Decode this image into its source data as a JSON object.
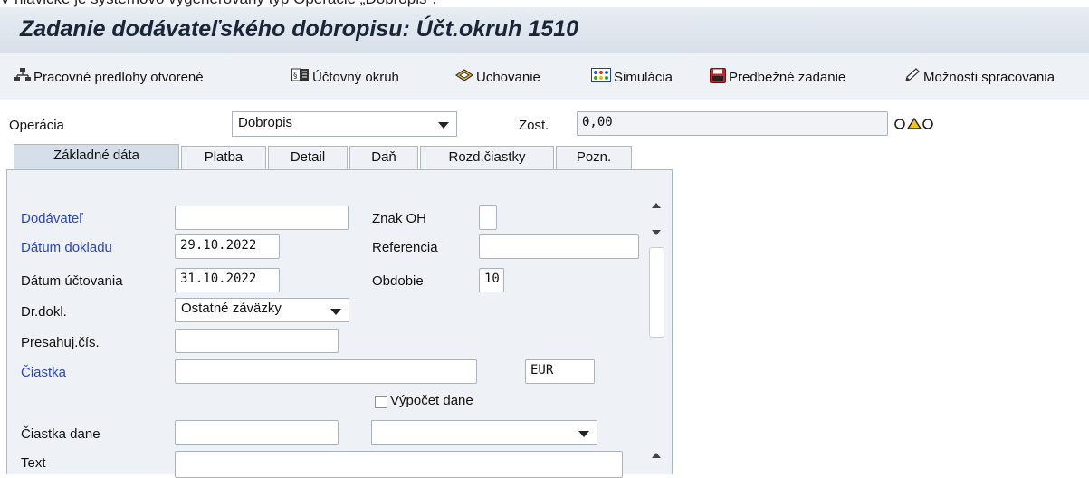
{
  "caption": "V hlavičke je systémovo vygenerovaný typ Operácie „Dobropis\".",
  "window": {
    "title": "Zadanie dodávateľského dobropisu: Účt.okruh 1510"
  },
  "toolbar": {
    "items": [
      {
        "label": "Pracovné predlohy otvorené",
        "icon": "worklist-tree-icon"
      },
      {
        "label": "Účtovný okruh",
        "icon": "company-code-icon"
      },
      {
        "label": "Uchovanie",
        "icon": "hold-icon"
      },
      {
        "label": "Simulácia",
        "icon": "simulate-icon"
      },
      {
        "label": "Predbežné zadanie",
        "icon": "save-icon"
      },
      {
        "label": "Možnosti spracovania",
        "icon": "pencil-icon"
      }
    ]
  },
  "header": {
    "operation_label": "Operácia",
    "operation_value": "Dobropis",
    "balance_label": "Zost.",
    "balance_value": "0,00"
  },
  "tabs": [
    {
      "label": "Základné dáta",
      "active": true
    },
    {
      "label": "Platba"
    },
    {
      "label": "Detail"
    },
    {
      "label": "Daň"
    },
    {
      "label": "Rozd.čiastky"
    },
    {
      "label": "Pozn."
    }
  ],
  "form": {
    "vendor_label": "Dodávateľ",
    "vendor_value": "",
    "doc_date_label": "Dátum dokladu",
    "doc_date_value": "29.10.2022",
    "posting_date_label": "Dátum účtovania",
    "posting_date_value": "31.10.2022",
    "doc_type_label": "Dr.dokl.",
    "doc_type_value": "Ostatné záväzky",
    "cross_cc_label": "Presahuj.čís.",
    "cross_cc_value": "",
    "amount_label": "Čiastka",
    "amount_value": "",
    "currency_value": "EUR",
    "calc_tax_label": "Výpočet dane",
    "tax_amount_label": "Čiastka dane",
    "tax_amount_value": "",
    "tax_code_value": "",
    "text_label": "Text",
    "text_value": "",
    "sgl_label": "Znak OH",
    "sgl_value": "",
    "reference_label": "Referencia",
    "reference_value": "",
    "period_label": "Obdobie",
    "period_value": "10"
  }
}
